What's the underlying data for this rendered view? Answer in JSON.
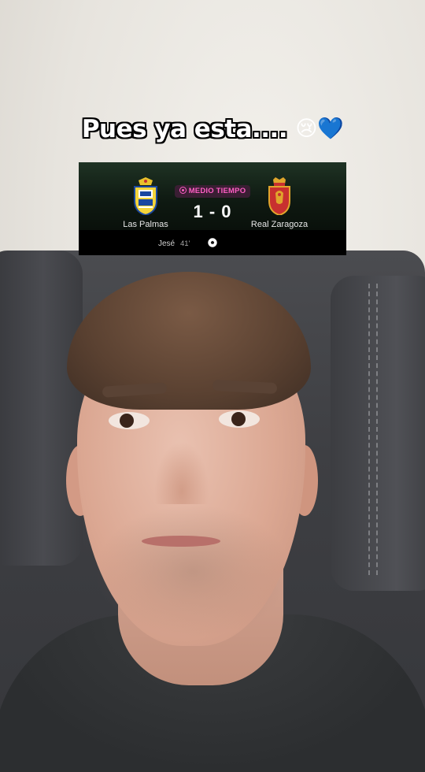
{
  "caption": {
    "text": "Pues ya esta....",
    "emojis": "😢💙"
  },
  "match": {
    "status": "MEDIO TIEMPO",
    "score": "1 - 0",
    "home_team": "Las Palmas",
    "away_team": "Real Zaragoza",
    "scorer": "Jesé",
    "goal_minute": "41'",
    "icons": {
      "status": "live-indicator-icon",
      "goal": "soccer-ball-icon",
      "home_crest": "las-palmas-crest-icon",
      "away_crest": "real-zaragoza-crest-icon"
    },
    "colors": {
      "status_text": "#ff5ec4",
      "status_bg": "#3a1e33"
    }
  }
}
